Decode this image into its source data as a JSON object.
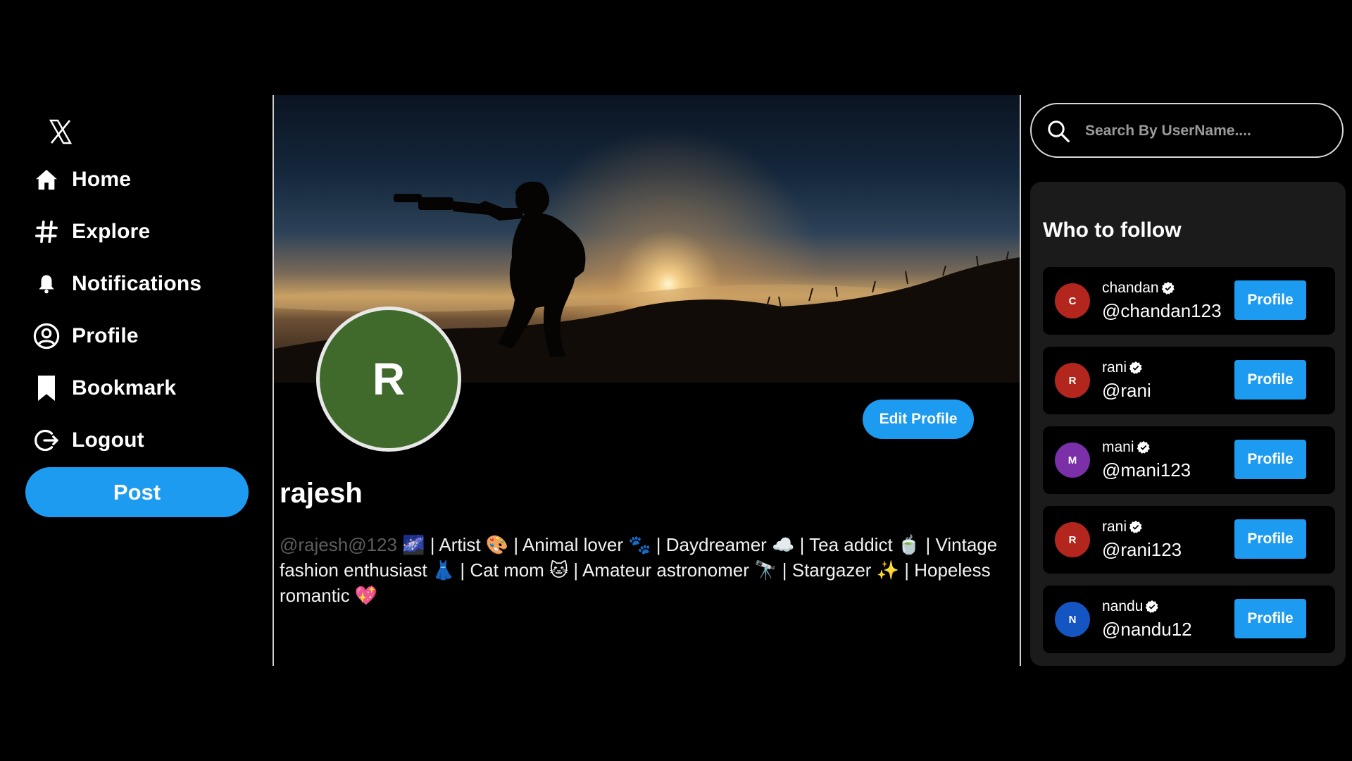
{
  "nav": {
    "logo": "x-logo",
    "items": [
      {
        "label": "Home",
        "icon": "home-icon"
      },
      {
        "label": "Explore",
        "icon": "hashtag-icon"
      },
      {
        "label": "Notifications",
        "icon": "bell-icon"
      },
      {
        "label": "Profile",
        "icon": "user-circle-icon"
      },
      {
        "label": "Bookmark",
        "icon": "bookmark-icon"
      },
      {
        "label": "Logout",
        "icon": "logout-icon"
      }
    ],
    "post_label": "Post"
  },
  "profile": {
    "avatar_letter": "R",
    "avatar_color": "#3f6a2c",
    "edit_label": "Edit Profile",
    "name": "rajesh",
    "handle": "@rajesh@123",
    "bio": " 🌌 | Artist 🎨 | Animal lover 🐾 | Daydreamer ☁️ | Tea addict 🍵 | Vintage fashion enthusiast 👗 | Cat mom 🐱 | Amateur astronomer 🔭 | Stargazer ✨ | Hopeless romantic 💖"
  },
  "search": {
    "placeholder": "Search By UserName...."
  },
  "who_to_follow": {
    "title": "Who to follow",
    "button_label": "Profile",
    "users": [
      {
        "name": "chandan",
        "handle": "@chandan123",
        "initial": "C",
        "color": "#b3261e"
      },
      {
        "name": "rani",
        "handle": "@rani",
        "initial": "R",
        "color": "#b3261e"
      },
      {
        "name": "mani",
        "handle": "@mani123",
        "initial": "M",
        "color": "#7b2fa8"
      },
      {
        "name": "rani",
        "handle": "@rani123",
        "initial": "R",
        "color": "#b3261e"
      },
      {
        "name": "nandu",
        "handle": "@nandu12",
        "initial": "N",
        "color": "#1455c2"
      }
    ]
  },
  "colors": {
    "accent": "#1d9bf0",
    "background": "#000000",
    "panel": "#1b1b1b"
  }
}
